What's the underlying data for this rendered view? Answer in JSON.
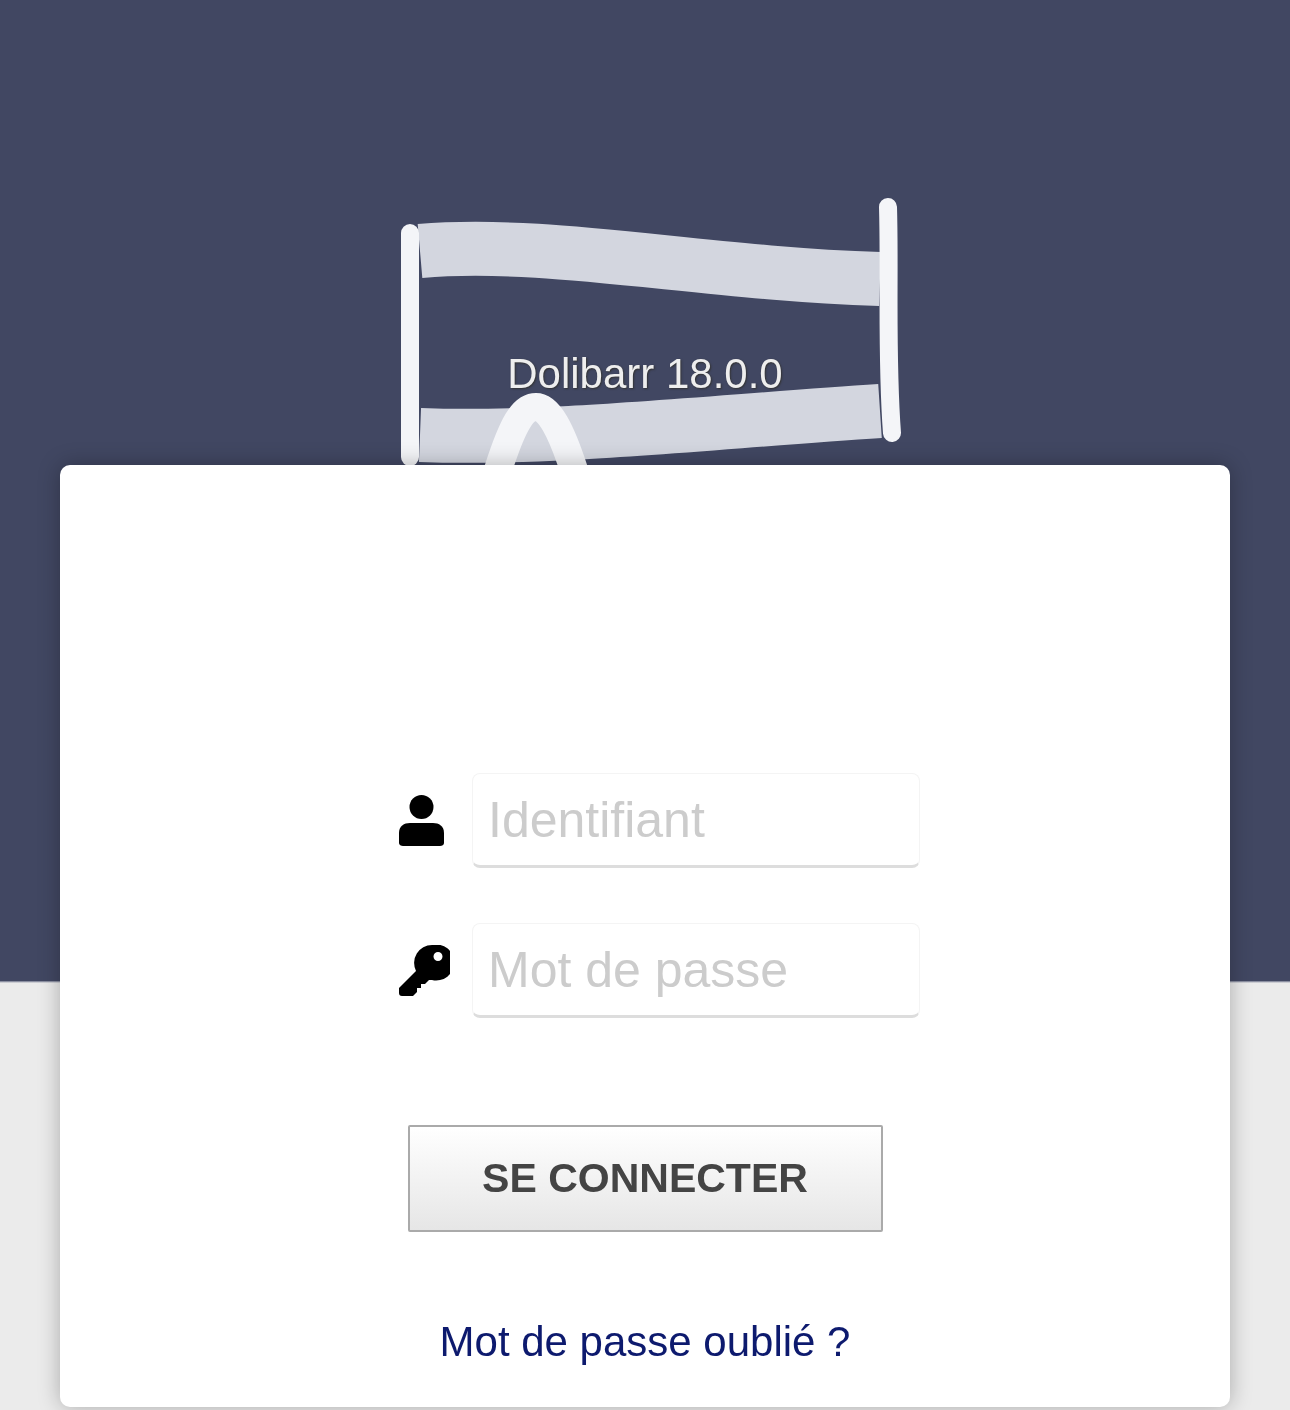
{
  "header": {
    "version": "Dolibarr 18.0.0"
  },
  "login_form": {
    "fields": [
      {
        "kind": "text",
        "placeholder": "Identifiant"
      },
      {
        "kind": "password",
        "placeholder": "Mot de passe"
      }
    ],
    "submit_button": "SE CONNECTER",
    "forgot_password_link": "Mot de passe oublié ?"
  }
}
